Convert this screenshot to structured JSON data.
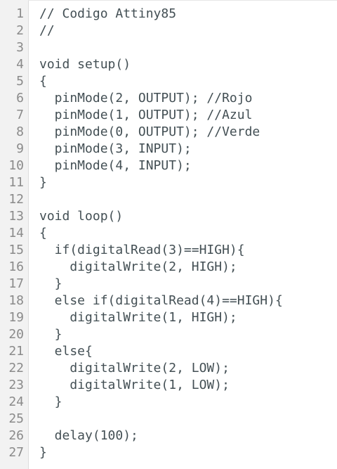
{
  "editor": {
    "lines": [
      "// Codigo Attiny85",
      "//",
      "",
      "void setup()",
      "{",
      "  pinMode(2, OUTPUT); //Rojo",
      "  pinMode(1, OUTPUT); //Azul",
      "  pinMode(0, OUTPUT); //Verde",
      "  pinMode(3, INPUT);",
      "  pinMode(4, INPUT);",
      "}",
      "",
      "void loop()",
      "{",
      "  if(digitalRead(3)==HIGH){",
      "    digitalWrite(2, HIGH);",
      "  }",
      "  else if(digitalRead(4)==HIGH){",
      "    digitalWrite(1, HIGH);",
      "  }",
      "  else{",
      "    digitalWrite(2, LOW);",
      "    digitalWrite(1, LOW);",
      "  }",
      "",
      "  delay(100);",
      "}"
    ]
  },
  "colors": {
    "line_numbers": "#8a8a8a",
    "code_text": "#434f54",
    "gutter_bg": "#f2f2f2"
  }
}
